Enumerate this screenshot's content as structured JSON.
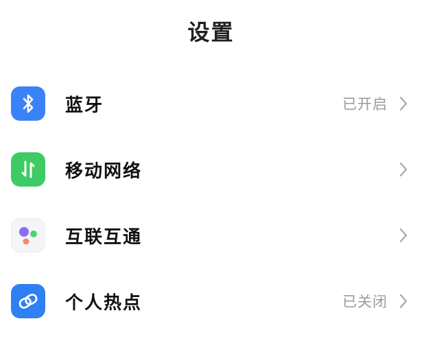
{
  "header": {
    "title": "设置"
  },
  "settings": {
    "items": [
      {
        "label": "蓝牙",
        "status": "已开启",
        "icon": "bluetooth-icon",
        "color": "#3a82f7"
      },
      {
        "label": "移动网络",
        "status": "",
        "icon": "mobile-network-icon",
        "color": "#3ecb63"
      },
      {
        "label": "互联互通",
        "status": "",
        "icon": "interconnect-icon",
        "color": "#f5f5f7"
      },
      {
        "label": "个人热点",
        "status": "已关闭",
        "icon": "hotspot-icon",
        "color": "#2f7ff5"
      }
    ]
  }
}
